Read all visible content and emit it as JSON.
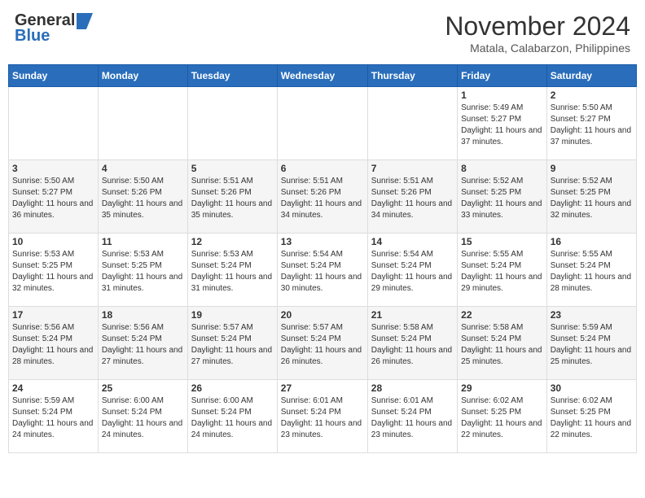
{
  "header": {
    "logo_general": "General",
    "logo_blue": "Blue",
    "month_title": "November 2024",
    "location": "Matala, Calabarzon, Philippines"
  },
  "weekdays": [
    "Sunday",
    "Monday",
    "Tuesday",
    "Wednesday",
    "Thursday",
    "Friday",
    "Saturday"
  ],
  "weeks": [
    [
      {
        "day": "",
        "sunrise": "",
        "sunset": "",
        "daylight": ""
      },
      {
        "day": "",
        "sunrise": "",
        "sunset": "",
        "daylight": ""
      },
      {
        "day": "",
        "sunrise": "",
        "sunset": "",
        "daylight": ""
      },
      {
        "day": "",
        "sunrise": "",
        "sunset": "",
        "daylight": ""
      },
      {
        "day": "",
        "sunrise": "",
        "sunset": "",
        "daylight": ""
      },
      {
        "day": "1",
        "sunrise": "Sunrise: 5:49 AM",
        "sunset": "Sunset: 5:27 PM",
        "daylight": "Daylight: 11 hours and 37 minutes."
      },
      {
        "day": "2",
        "sunrise": "Sunrise: 5:50 AM",
        "sunset": "Sunset: 5:27 PM",
        "daylight": "Daylight: 11 hours and 37 minutes."
      }
    ],
    [
      {
        "day": "3",
        "sunrise": "Sunrise: 5:50 AM",
        "sunset": "Sunset: 5:27 PM",
        "daylight": "Daylight: 11 hours and 36 minutes."
      },
      {
        "day": "4",
        "sunrise": "Sunrise: 5:50 AM",
        "sunset": "Sunset: 5:26 PM",
        "daylight": "Daylight: 11 hours and 35 minutes."
      },
      {
        "day": "5",
        "sunrise": "Sunrise: 5:51 AM",
        "sunset": "Sunset: 5:26 PM",
        "daylight": "Daylight: 11 hours and 35 minutes."
      },
      {
        "day": "6",
        "sunrise": "Sunrise: 5:51 AM",
        "sunset": "Sunset: 5:26 PM",
        "daylight": "Daylight: 11 hours and 34 minutes."
      },
      {
        "day": "7",
        "sunrise": "Sunrise: 5:51 AM",
        "sunset": "Sunset: 5:26 PM",
        "daylight": "Daylight: 11 hours and 34 minutes."
      },
      {
        "day": "8",
        "sunrise": "Sunrise: 5:52 AM",
        "sunset": "Sunset: 5:25 PM",
        "daylight": "Daylight: 11 hours and 33 minutes."
      },
      {
        "day": "9",
        "sunrise": "Sunrise: 5:52 AM",
        "sunset": "Sunset: 5:25 PM",
        "daylight": "Daylight: 11 hours and 32 minutes."
      }
    ],
    [
      {
        "day": "10",
        "sunrise": "Sunrise: 5:53 AM",
        "sunset": "Sunset: 5:25 PM",
        "daylight": "Daylight: 11 hours and 32 minutes."
      },
      {
        "day": "11",
        "sunrise": "Sunrise: 5:53 AM",
        "sunset": "Sunset: 5:25 PM",
        "daylight": "Daylight: 11 hours and 31 minutes."
      },
      {
        "day": "12",
        "sunrise": "Sunrise: 5:53 AM",
        "sunset": "Sunset: 5:24 PM",
        "daylight": "Daylight: 11 hours and 31 minutes."
      },
      {
        "day": "13",
        "sunrise": "Sunrise: 5:54 AM",
        "sunset": "Sunset: 5:24 PM",
        "daylight": "Daylight: 11 hours and 30 minutes."
      },
      {
        "day": "14",
        "sunrise": "Sunrise: 5:54 AM",
        "sunset": "Sunset: 5:24 PM",
        "daylight": "Daylight: 11 hours and 29 minutes."
      },
      {
        "day": "15",
        "sunrise": "Sunrise: 5:55 AM",
        "sunset": "Sunset: 5:24 PM",
        "daylight": "Daylight: 11 hours and 29 minutes."
      },
      {
        "day": "16",
        "sunrise": "Sunrise: 5:55 AM",
        "sunset": "Sunset: 5:24 PM",
        "daylight": "Daylight: 11 hours and 28 minutes."
      }
    ],
    [
      {
        "day": "17",
        "sunrise": "Sunrise: 5:56 AM",
        "sunset": "Sunset: 5:24 PM",
        "daylight": "Daylight: 11 hours and 28 minutes."
      },
      {
        "day": "18",
        "sunrise": "Sunrise: 5:56 AM",
        "sunset": "Sunset: 5:24 PM",
        "daylight": "Daylight: 11 hours and 27 minutes."
      },
      {
        "day": "19",
        "sunrise": "Sunrise: 5:57 AM",
        "sunset": "Sunset: 5:24 PM",
        "daylight": "Daylight: 11 hours and 27 minutes."
      },
      {
        "day": "20",
        "sunrise": "Sunrise: 5:57 AM",
        "sunset": "Sunset: 5:24 PM",
        "daylight": "Daylight: 11 hours and 26 minutes."
      },
      {
        "day": "21",
        "sunrise": "Sunrise: 5:58 AM",
        "sunset": "Sunset: 5:24 PM",
        "daylight": "Daylight: 11 hours and 26 minutes."
      },
      {
        "day": "22",
        "sunrise": "Sunrise: 5:58 AM",
        "sunset": "Sunset: 5:24 PM",
        "daylight": "Daylight: 11 hours and 25 minutes."
      },
      {
        "day": "23",
        "sunrise": "Sunrise: 5:59 AM",
        "sunset": "Sunset: 5:24 PM",
        "daylight": "Daylight: 11 hours and 25 minutes."
      }
    ],
    [
      {
        "day": "24",
        "sunrise": "Sunrise: 5:59 AM",
        "sunset": "Sunset: 5:24 PM",
        "daylight": "Daylight: 11 hours and 24 minutes."
      },
      {
        "day": "25",
        "sunrise": "Sunrise: 6:00 AM",
        "sunset": "Sunset: 5:24 PM",
        "daylight": "Daylight: 11 hours and 24 minutes."
      },
      {
        "day": "26",
        "sunrise": "Sunrise: 6:00 AM",
        "sunset": "Sunset: 5:24 PM",
        "daylight": "Daylight: 11 hours and 24 minutes."
      },
      {
        "day": "27",
        "sunrise": "Sunrise: 6:01 AM",
        "sunset": "Sunset: 5:24 PM",
        "daylight": "Daylight: 11 hours and 23 minutes."
      },
      {
        "day": "28",
        "sunrise": "Sunrise: 6:01 AM",
        "sunset": "Sunset: 5:24 PM",
        "daylight": "Daylight: 11 hours and 23 minutes."
      },
      {
        "day": "29",
        "sunrise": "Sunrise: 6:02 AM",
        "sunset": "Sunset: 5:25 PM",
        "daylight": "Daylight: 11 hours and 22 minutes."
      },
      {
        "day": "30",
        "sunrise": "Sunrise: 6:02 AM",
        "sunset": "Sunset: 5:25 PM",
        "daylight": "Daylight: 11 hours and 22 minutes."
      }
    ]
  ]
}
